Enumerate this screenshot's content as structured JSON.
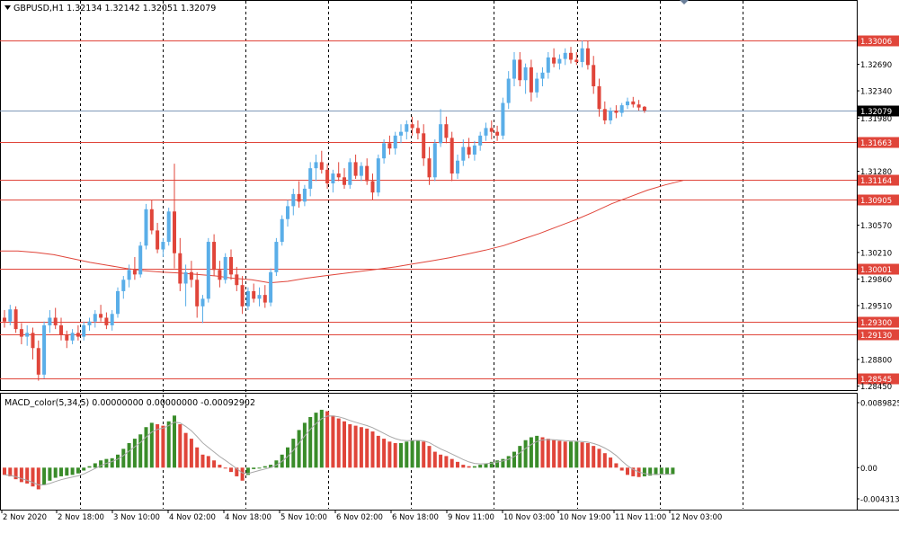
{
  "chart_data": {
    "type": "candlestick",
    "symbol_header": {
      "text": "GBPUSD,H1  1.32134 1.32142 1.32051 1.32079",
      "open": 1.32134,
      "high": 1.32142,
      "low": 1.32051,
      "close": 1.32079
    },
    "price_axis": {
      "ylim": [
        1.2842,
        1.333
      ],
      "ticks": [
        "1.32690",
        "1.32340",
        "1.31980",
        "1.31280",
        "1.30570",
        "1.30210",
        "1.29860",
        "1.29510",
        "1.28800",
        "1.28450"
      ]
    },
    "time_axis": {
      "labels": [
        "2 Nov 2020",
        "2 Nov 18:00",
        "3 Nov 10:00",
        "4 Nov 02:00",
        "4 Nov 18:00",
        "5 Nov 10:00",
        "6 Nov 02:00",
        "6 Nov 18:00",
        "9 Nov 11:00",
        "10 Nov 03:00",
        "10 Nov 19:00",
        "11 Nov 11:00",
        "12 Nov 03:00"
      ]
    },
    "current_price": {
      "label": "1.32079",
      "value": 1.32079
    },
    "horizontal_levels": [
      {
        "label": "1.33006",
        "value": 1.33006
      },
      {
        "label": "1.31663",
        "value": 1.31663
      },
      {
        "label": "1.31164",
        "value": 1.31164
      },
      {
        "label": "1.30905",
        "value": 1.30905
      },
      {
        "label": "1.30001",
        "value": 1.30001
      },
      {
        "label": "1.29300",
        "value": 1.293
      },
      {
        "label": "1.29130",
        "value": 1.2913
      },
      {
        "label": "1.28545",
        "value": 1.28545
      }
    ],
    "moving_average": {
      "x": [
        0,
        20,
        40,
        60,
        80,
        100,
        120,
        140,
        160,
        180,
        200,
        220,
        240,
        260,
        280,
        300,
        320,
        340,
        360,
        380,
        400,
        420,
        440,
        460,
        480,
        500,
        520,
        540,
        560,
        580,
        600,
        620,
        640,
        660,
        680,
        700,
        720,
        740,
        760
      ],
      "values": [
        1.3023,
        1.3023,
        1.3021,
        1.3018,
        1.3013,
        1.3008,
        1.3004,
        1.3,
        1.2997,
        1.2995,
        1.2994,
        1.2992,
        1.299,
        1.2987,
        1.2985,
        1.2981,
        1.2983,
        1.2987,
        1.299,
        1.2993,
        1.2996,
        1.2999,
        1.3002,
        1.3006,
        1.301,
        1.3014,
        1.3019,
        1.3024,
        1.303,
        1.3038,
        1.3046,
        1.3055,
        1.3064,
        1.3074,
        1.3085,
        1.3094,
        1.3103,
        1.311,
        1.3116
      ]
    },
    "candles": [
      {
        "o": 1.2935,
        "h": 1.2945,
        "l": 1.2922,
        "c": 1.293
      },
      {
        "o": 1.293,
        "h": 1.2952,
        "l": 1.2925,
        "c": 1.2946
      },
      {
        "o": 1.2946,
        "h": 1.295,
        "l": 1.2915,
        "c": 1.292
      },
      {
        "o": 1.292,
        "h": 1.2928,
        "l": 1.29,
        "c": 1.291
      },
      {
        "o": 1.291,
        "h": 1.2925,
        "l": 1.2898,
        "c": 1.2915
      },
      {
        "o": 1.2915,
        "h": 1.2922,
        "l": 1.288,
        "c": 1.2895
      },
      {
        "o": 1.2895,
        "h": 1.2905,
        "l": 1.2852,
        "c": 1.286
      },
      {
        "o": 1.286,
        "h": 1.293,
        "l": 1.2855,
        "c": 1.2925
      },
      {
        "o": 1.2925,
        "h": 1.2945,
        "l": 1.2915,
        "c": 1.2935
      },
      {
        "o": 1.2935,
        "h": 1.2948,
        "l": 1.292,
        "c": 1.2925
      },
      {
        "o": 1.2925,
        "h": 1.2935,
        "l": 1.2905,
        "c": 1.2912
      },
      {
        "o": 1.2912,
        "h": 1.2918,
        "l": 1.2895,
        "c": 1.2905
      },
      {
        "o": 1.2905,
        "h": 1.292,
        "l": 1.29,
        "c": 1.2915
      },
      {
        "o": 1.2915,
        "h": 1.2925,
        "l": 1.2905,
        "c": 1.291
      },
      {
        "o": 1.291,
        "h": 1.293,
        "l": 1.2905,
        "c": 1.2925
      },
      {
        "o": 1.2925,
        "h": 1.2935,
        "l": 1.2918,
        "c": 1.293
      },
      {
        "o": 1.293,
        "h": 1.2945,
        "l": 1.2922,
        "c": 1.294
      },
      {
        "o": 1.294,
        "h": 1.2952,
        "l": 1.293,
        "c": 1.2935
      },
      {
        "o": 1.2935,
        "h": 1.2942,
        "l": 1.292,
        "c": 1.2925
      },
      {
        "o": 1.2925,
        "h": 1.2945,
        "l": 1.2918,
        "c": 1.294
      },
      {
        "o": 1.294,
        "h": 1.2975,
        "l": 1.2935,
        "c": 1.297
      },
      {
        "o": 1.297,
        "h": 1.299,
        "l": 1.296,
        "c": 1.2985
      },
      {
        "o": 1.2985,
        "h": 1.3005,
        "l": 1.2975,
        "c": 1.2998
      },
      {
        "o": 1.2998,
        "h": 1.3015,
        "l": 1.2985,
        "c": 1.2992
      },
      {
        "o": 1.2992,
        "h": 1.3035,
        "l": 1.2988,
        "c": 1.303
      },
      {
        "o": 1.303,
        "h": 1.3085,
        "l": 1.3025,
        "c": 1.3078
      },
      {
        "o": 1.3078,
        "h": 1.309,
        "l": 1.3045,
        "c": 1.305
      },
      {
        "o": 1.305,
        "h": 1.306,
        "l": 1.302,
        "c": 1.3025
      },
      {
        "o": 1.3025,
        "h": 1.304,
        "l": 1.3015,
        "c": 1.3035
      },
      {
        "o": 1.3035,
        "h": 1.308,
        "l": 1.303,
        "c": 1.3075
      },
      {
        "o": 1.3075,
        "h": 1.3138,
        "l": 1.3,
        "c": 1.302
      },
      {
        "o": 1.302,
        "h": 1.304,
        "l": 1.297,
        "c": 1.298
      },
      {
        "o": 1.298,
        "h": 1.3005,
        "l": 1.295,
        "c": 1.2995
      },
      {
        "o": 1.2995,
        "h": 1.301,
        "l": 1.2975,
        "c": 1.2985
      },
      {
        "o": 1.2985,
        "h": 1.2995,
        "l": 1.2935,
        "c": 1.295
      },
      {
        "o": 1.295,
        "h": 1.2965,
        "l": 1.2928,
        "c": 1.296
      },
      {
        "o": 1.296,
        "h": 1.304,
        "l": 1.2955,
        "c": 1.3035
      },
      {
        "o": 1.3035,
        "h": 1.3045,
        "l": 1.299,
        "c": 1.2998
      },
      {
        "o": 1.2998,
        "h": 1.301,
        "l": 1.2975,
        "c": 1.2985
      },
      {
        "o": 1.2985,
        "h": 1.302,
        "l": 1.298,
        "c": 1.3015
      },
      {
        "o": 1.3015,
        "h": 1.3025,
        "l": 1.2985,
        "c": 1.2992
      },
      {
        "o": 1.2992,
        "h": 1.3002,
        "l": 1.297,
        "c": 1.2978
      },
      {
        "o": 1.2978,
        "h": 1.299,
        "l": 1.294,
        "c": 1.295
      },
      {
        "o": 1.295,
        "h": 1.2975,
        "l": 1.2945,
        "c": 1.297
      },
      {
        "o": 1.297,
        "h": 1.298,
        "l": 1.2955,
        "c": 1.296
      },
      {
        "o": 1.296,
        "h": 1.2975,
        "l": 1.295,
        "c": 1.2965
      },
      {
        "o": 1.2965,
        "h": 1.2978,
        "l": 1.2948,
        "c": 1.2955
      },
      {
        "o": 1.2955,
        "h": 1.3,
        "l": 1.295,
        "c": 1.2995
      },
      {
        "o": 1.2995,
        "h": 1.304,
        "l": 1.299,
        "c": 1.3035
      },
      {
        "o": 1.3035,
        "h": 1.307,
        "l": 1.303,
        "c": 1.3065
      },
      {
        "o": 1.3065,
        "h": 1.309,
        "l": 1.3055,
        "c": 1.3082
      },
      {
        "o": 1.3082,
        "h": 1.3105,
        "l": 1.307,
        "c": 1.3098
      },
      {
        "o": 1.3098,
        "h": 1.3115,
        "l": 1.308,
        "c": 1.3088
      },
      {
        "o": 1.3088,
        "h": 1.311,
        "l": 1.3082,
        "c": 1.3105
      },
      {
        "o": 1.3105,
        "h": 1.314,
        "l": 1.3095,
        "c": 1.3132
      },
      {
        "o": 1.3132,
        "h": 1.315,
        "l": 1.3115,
        "c": 1.314
      },
      {
        "o": 1.314,
        "h": 1.3155,
        "l": 1.3125,
        "c": 1.313
      },
      {
        "o": 1.313,
        "h": 1.3138,
        "l": 1.3105,
        "c": 1.3112
      },
      {
        "o": 1.3112,
        "h": 1.313,
        "l": 1.31,
        "c": 1.3125
      },
      {
        "o": 1.3125,
        "h": 1.314,
        "l": 1.3115,
        "c": 1.312
      },
      {
        "o": 1.312,
        "h": 1.3132,
        "l": 1.3105,
        "c": 1.311
      },
      {
        "o": 1.311,
        "h": 1.3145,
        "l": 1.3105,
        "c": 1.314
      },
      {
        "o": 1.314,
        "h": 1.315,
        "l": 1.3118,
        "c": 1.3122
      },
      {
        "o": 1.3122,
        "h": 1.314,
        "l": 1.3115,
        "c": 1.3135
      },
      {
        "o": 1.3135,
        "h": 1.3145,
        "l": 1.311,
        "c": 1.3115
      },
      {
        "o": 1.3115,
        "h": 1.3125,
        "l": 1.309,
        "c": 1.31
      },
      {
        "o": 1.31,
        "h": 1.315,
        "l": 1.3095,
        "c": 1.3145
      },
      {
        "o": 1.3145,
        "h": 1.317,
        "l": 1.3138,
        "c": 1.3165
      },
      {
        "o": 1.3165,
        "h": 1.3175,
        "l": 1.315,
        "c": 1.3158
      },
      {
        "o": 1.3158,
        "h": 1.318,
        "l": 1.315,
        "c": 1.3175
      },
      {
        "o": 1.3175,
        "h": 1.319,
        "l": 1.3165,
        "c": 1.318
      },
      {
        "o": 1.318,
        "h": 1.3195,
        "l": 1.317,
        "c": 1.319
      },
      {
        "o": 1.319,
        "h": 1.32,
        "l": 1.3175,
        "c": 1.3185
      },
      {
        "o": 1.3185,
        "h": 1.3195,
        "l": 1.317,
        "c": 1.3178
      },
      {
        "o": 1.3178,
        "h": 1.319,
        "l": 1.3135,
        "c": 1.3145
      },
      {
        "o": 1.3145,
        "h": 1.316,
        "l": 1.311,
        "c": 1.312
      },
      {
        "o": 1.312,
        "h": 1.317,
        "l": 1.3115,
        "c": 1.3165
      },
      {
        "o": 1.3165,
        "h": 1.321,
        "l": 1.316,
        "c": 1.319
      },
      {
        "o": 1.319,
        "h": 1.32,
        "l": 1.3165,
        "c": 1.3172
      },
      {
        "o": 1.3172,
        "h": 1.318,
        "l": 1.3115,
        "c": 1.3125
      },
      {
        "o": 1.3125,
        "h": 1.315,
        "l": 1.3118,
        "c": 1.3142
      },
      {
        "o": 1.3142,
        "h": 1.317,
        "l": 1.3135,
        "c": 1.316
      },
      {
        "o": 1.316,
        "h": 1.3172,
        "l": 1.3145,
        "c": 1.315
      },
      {
        "o": 1.315,
        "h": 1.3168,
        "l": 1.3142,
        "c": 1.3162
      },
      {
        "o": 1.3162,
        "h": 1.318,
        "l": 1.3155,
        "c": 1.3175
      },
      {
        "o": 1.3175,
        "h": 1.3192,
        "l": 1.3168,
        "c": 1.3185
      },
      {
        "o": 1.3185,
        "h": 1.3195,
        "l": 1.317,
        "c": 1.318
      },
      {
        "o": 1.318,
        "h": 1.3188,
        "l": 1.3168,
        "c": 1.3175
      },
      {
        "o": 1.3175,
        "h": 1.3225,
        "l": 1.317,
        "c": 1.3218
      },
      {
        "o": 1.3218,
        "h": 1.326,
        "l": 1.321,
        "c": 1.325
      },
      {
        "o": 1.325,
        "h": 1.3285,
        "l": 1.324,
        "c": 1.3275
      },
      {
        "o": 1.3275,
        "h": 1.3285,
        "l": 1.324,
        "c": 1.3248
      },
      {
        "o": 1.3248,
        "h": 1.327,
        "l": 1.323,
        "c": 1.3265
      },
      {
        "o": 1.3265,
        "h": 1.3275,
        "l": 1.322,
        "c": 1.3232
      },
      {
        "o": 1.3232,
        "h": 1.3258,
        "l": 1.3225,
        "c": 1.325
      },
      {
        "o": 1.325,
        "h": 1.3265,
        "l": 1.324,
        "c": 1.3258
      },
      {
        "o": 1.3258,
        "h": 1.3285,
        "l": 1.325,
        "c": 1.3278
      },
      {
        "o": 1.3278,
        "h": 1.329,
        "l": 1.3265,
        "c": 1.327
      },
      {
        "o": 1.327,
        "h": 1.3282,
        "l": 1.3262,
        "c": 1.3276
      },
      {
        "o": 1.3276,
        "h": 1.329,
        "l": 1.3268,
        "c": 1.3284
      },
      {
        "o": 1.3284,
        "h": 1.3292,
        "l": 1.327,
        "c": 1.3275
      },
      {
        "o": 1.3275,
        "h": 1.3285,
        "l": 1.3268,
        "c": 1.3272
      },
      {
        "o": 1.3272,
        "h": 1.33,
        "l": 1.3265,
        "c": 1.329
      },
      {
        "o": 1.329,
        "h": 1.33,
        "l": 1.3262,
        "c": 1.3268
      },
      {
        "o": 1.3268,
        "h": 1.328,
        "l": 1.323,
        "c": 1.324
      },
      {
        "o": 1.324,
        "h": 1.325,
        "l": 1.32,
        "c": 1.321
      },
      {
        "o": 1.321,
        "h": 1.322,
        "l": 1.319,
        "c": 1.3195
      },
      {
        "o": 1.3195,
        "h": 1.3212,
        "l": 1.319,
        "c": 1.3208
      },
      {
        "o": 1.3208,
        "h": 1.3215,
        "l": 1.3198,
        "c": 1.3205
      },
      {
        "o": 1.3205,
        "h": 1.3218,
        "l": 1.32,
        "c": 1.3215
      },
      {
        "o": 1.3215,
        "h": 1.3225,
        "l": 1.321,
        "c": 1.322
      },
      {
        "o": 1.322,
        "h": 1.3226,
        "l": 1.3212,
        "c": 1.3216
      },
      {
        "o": 1.3216,
        "h": 1.3222,
        "l": 1.3208,
        "c": 1.3212
      },
      {
        "o": 1.3213,
        "h": 1.3214,
        "l": 1.3205,
        "c": 1.3208
      }
    ],
    "macd": {
      "title": "MACD_color(5,34,5) 0.00000000 0.00000000 -0.00092902",
      "ylim": [
        -0.004313,
        0.0089825
      ],
      "ticks": [
        "0.0089825",
        "0.00",
        "-0.004313"
      ],
      "values": [
        -0.001,
        -0.0012,
        -0.0016,
        -0.002,
        -0.0022,
        -0.0026,
        -0.003,
        -0.0024,
        -0.0018,
        -0.0014,
        -0.0012,
        -0.0011,
        -0.001,
        -0.0008,
        -0.0004,
        0.0002,
        0.0006,
        0.001,
        0.0012,
        0.0013,
        0.0018,
        0.0026,
        0.0034,
        0.004,
        0.0046,
        0.0056,
        0.0062,
        0.006,
        0.0058,
        0.0064,
        0.0072,
        0.006,
        0.0048,
        0.004,
        0.0028,
        0.0018,
        0.0016,
        0.001,
        0.0004,
        0.0,
        -0.0006,
        -0.0012,
        -0.0018,
        -0.001,
        -0.0002,
        0.0,
        0.0002,
        0.0004,
        0.001,
        0.0018,
        0.0028,
        0.004,
        0.0052,
        0.0062,
        0.007,
        0.0076,
        0.008,
        0.0078,
        0.0072,
        0.0068,
        0.0064,
        0.006,
        0.0058,
        0.0056,
        0.0054,
        0.005,
        0.0044,
        0.004,
        0.0036,
        0.0034,
        0.0034,
        0.0036,
        0.0038,
        0.0038,
        0.0036,
        0.003,
        0.0022,
        0.0018,
        0.0016,
        0.0012,
        0.0008,
        0.0004,
        0.0002,
        0.0002,
        0.0004,
        0.0006,
        0.0008,
        0.001,
        0.0012,
        0.0016,
        0.0022,
        0.003,
        0.0038,
        0.0042,
        0.0044,
        0.0042,
        0.004,
        0.0038,
        0.0037,
        0.0036,
        0.0036,
        0.0036,
        0.0035,
        0.0034,
        0.003,
        0.0026,
        0.002,
        0.0014,
        0.0006,
        -0.0004,
        -0.001,
        -0.0012,
        -0.0013,
        -0.0012,
        -0.0011,
        -0.001,
        -0.0009,
        -0.0009,
        -0.0009
      ]
    }
  }
}
